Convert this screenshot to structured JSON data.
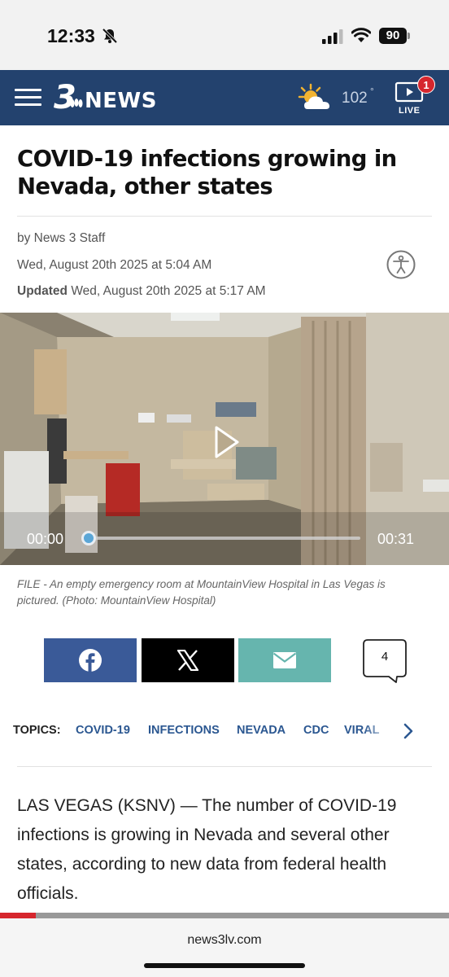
{
  "status_bar": {
    "time": "12:33",
    "battery": "90"
  },
  "header": {
    "logo_number": "3",
    "logo_text": "NEWS",
    "temperature": "102",
    "temperature_unit": "°",
    "live_label": "LIVE",
    "live_badge_count": "1"
  },
  "article": {
    "headline": "COVID-19 infections growing in Nevada, other states",
    "byline": "by News 3 Staff",
    "published": "Wed, August 20th 2025 at 5:04 AM",
    "updated_label": "Updated",
    "updated": "Wed, August 20th 2025 at 5:17 AM"
  },
  "video": {
    "current_time": "00:00",
    "duration": "00:31",
    "progress": 0.0
  },
  "caption": "FILE - An empty emergency room at MountainView Hospital in Las Vegas is pictured. (Photo: MountainView Hospital)",
  "share": {
    "comment_count": "4"
  },
  "topics": {
    "label": "TOPICS:",
    "items": [
      "COVID-19",
      "INFECTIONS",
      "NEVADA",
      "CDC",
      "VIRAL"
    ]
  },
  "body": {
    "paragraph1": "LAS VEGAS (KSNV) — The number of COVID-19 infections is growing in Nevada and several other states, according to new data from federal health officials."
  },
  "browser": {
    "url": "news3lv.com",
    "read_progress": 0.08
  },
  "colors": {
    "header_bg": "#23426e",
    "facebook": "#3a5a98",
    "x": "#000000",
    "email": "#66b5ae",
    "topic_link": "#2b5791",
    "accent_red": "#d6262d"
  },
  "icons": [
    "bell-slash-icon",
    "signal-icon",
    "wifi-icon",
    "menu-icon",
    "weather-sun-cloud-icon",
    "live-tv-icon",
    "accessibility-icon",
    "play-icon",
    "facebook-icon",
    "x-icon",
    "email-icon",
    "comment-icon",
    "chevron-right-icon"
  ]
}
